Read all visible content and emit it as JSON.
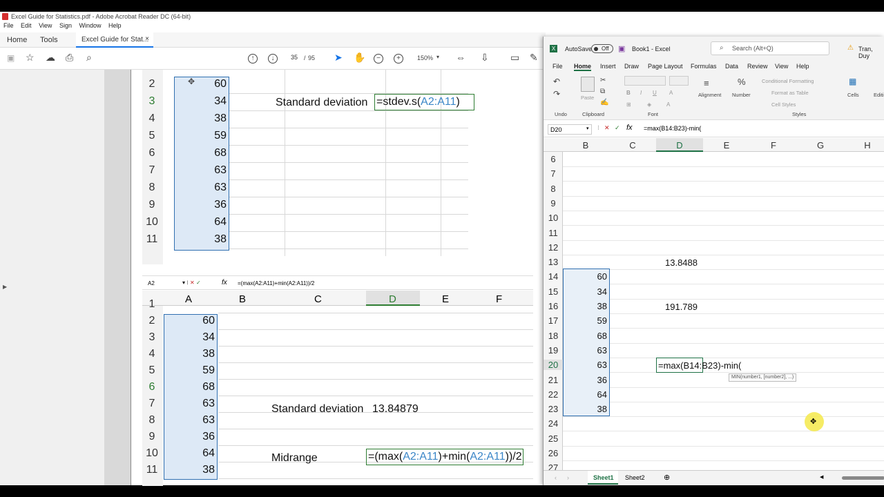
{
  "acrobat": {
    "title": "Excel Guide for Statistics.pdf - Adobe Acrobat Reader DC (64-bit)",
    "menu": [
      "File",
      "Edit",
      "View",
      "Sign",
      "Window",
      "Help"
    ],
    "tab_home": "Home",
    "tab_tools": "Tools",
    "tab_doc": "Excel Guide for Stat...",
    "tab_close": "×",
    "page_current": "35",
    "page_sep": "/",
    "page_total": "95",
    "zoom": "150%"
  },
  "pdf_top": {
    "rows": [
      "2",
      "3",
      "4",
      "5",
      "6",
      "7",
      "8",
      "9",
      "10",
      "11"
    ],
    "values": [
      "60",
      "34",
      "38",
      "59",
      "68",
      "63",
      "63",
      "36",
      "64",
      "38"
    ],
    "label": "Standard deviation",
    "formula_pre": "=stdev.s(",
    "formula_ref": "A2:A11",
    "formula_post": ")"
  },
  "pdf_bottom": {
    "namebox": "A2",
    "fx": "fx",
    "formula_bar": "=(max(A2:A11)+min(A2:A11))/2",
    "columns": [
      "A",
      "B",
      "C",
      "D",
      "E",
      "F"
    ],
    "rows": [
      "1",
      "2",
      "3",
      "4",
      "5",
      "6",
      "7",
      "8",
      "9",
      "10",
      "11"
    ],
    "values": [
      "60",
      "34",
      "38",
      "59",
      "68",
      "63",
      "63",
      "36",
      "64",
      "38"
    ],
    "label_sd": "Standard deviation",
    "value_sd": "13.84879",
    "label_mid": "Midrange",
    "mid_1": "=(max(",
    "mid_ref1": "A2:A11",
    "mid_2": ")+min(",
    "mid_ref2": "A2:A11",
    "mid_3": "))/2"
  },
  "excel": {
    "autosave": "AutoSave",
    "toggle": "Off",
    "book": "Book1  -  Excel",
    "search": "Search (Alt+Q)",
    "user": "Tran, Duy",
    "tabs": [
      "File",
      "Home",
      "Insert",
      "Draw",
      "Page Layout",
      "Formulas",
      "Data",
      "Review",
      "View",
      "Help"
    ],
    "groups": {
      "undo": "Undo",
      "clipboard": "Clipboard",
      "font": "Font",
      "alignment": "Alignment",
      "number": "Number",
      "styles": "Styles",
      "cells": "Cells",
      "editing": "Editin",
      "paste": "Paste"
    },
    "styles_items": [
      "Conditional Formatting",
      "Format as Table",
      "Cell Styles"
    ],
    "namebox": "D20",
    "formula": "=max(B14:B23)-min(",
    "columns": [
      "B",
      "C",
      "D",
      "E",
      "F",
      "G",
      "H"
    ],
    "rows": [
      "6",
      "7",
      "8",
      "9",
      "10",
      "11",
      "12",
      "13",
      "14",
      "15",
      "16",
      "17",
      "18",
      "19",
      "20",
      "21",
      "22",
      "23",
      "24",
      "25",
      "26",
      "27"
    ],
    "values": [
      "60",
      "34",
      "38",
      "59",
      "68",
      "63",
      "63",
      "36",
      "64",
      "38"
    ],
    "d13": "13.8488",
    "d16": "191.789",
    "edit_pre": "=max(",
    "edit_ref": "B14:B23",
    "edit_post": ")-min(",
    "tooltip": "MIN(number1, [number2], ...)",
    "sheet1": "Sheet1",
    "sheet2": "Sheet2"
  }
}
